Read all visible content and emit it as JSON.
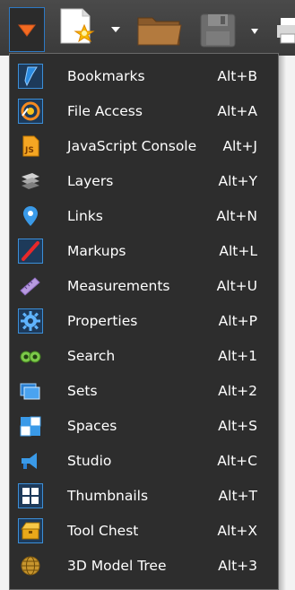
{
  "colors": {
    "toolbar_bg": "#3f3f3f",
    "menu_bg": "#2d2d2d",
    "menu_border": "#6b6b6b",
    "selected_frame": "#3c8fd8",
    "text": "#ffffff",
    "accent_orange": "#f36b21"
  },
  "toolbar": {
    "buttons": [
      {
        "id": "panels",
        "icon": "orange-down-triangle-icon"
      },
      {
        "id": "new",
        "icon": "new-document-icon",
        "has_dropdown": true
      },
      {
        "id": "open",
        "icon": "folder-icon"
      },
      {
        "id": "save",
        "icon": "floppy-disk-icon",
        "has_dropdown": true
      },
      {
        "id": "print",
        "icon": "printer-icon"
      }
    ]
  },
  "menu": {
    "items": [
      {
        "label": "Bookmarks",
        "shortcut": "Alt+B",
        "icon": "bookmark-icon",
        "selected": true
      },
      {
        "label": "File Access",
        "shortcut": "Alt+A",
        "icon": "file-access-icon",
        "selected": true
      },
      {
        "label": "JavaScript Console",
        "shortcut": "Alt+J",
        "icon": "javascript-icon",
        "selected": false
      },
      {
        "label": "Layers",
        "shortcut": "Alt+Y",
        "icon": "layers-icon",
        "selected": false
      },
      {
        "label": "Links",
        "shortcut": "Alt+N",
        "icon": "link-pin-icon",
        "selected": false
      },
      {
        "label": "Markups",
        "shortcut": "Alt+L",
        "icon": "markup-pen-icon",
        "selected": true
      },
      {
        "label": "Measurements",
        "shortcut": "Alt+U",
        "icon": "ruler-icon",
        "selected": false
      },
      {
        "label": "Properties",
        "shortcut": "Alt+P",
        "icon": "gear-icon",
        "selected": true
      },
      {
        "label": "Search",
        "shortcut": "Alt+1",
        "icon": "binoculars-icon",
        "selected": false
      },
      {
        "label": "Sets",
        "shortcut": "Alt+2",
        "icon": "sets-icon",
        "selected": false
      },
      {
        "label": "Spaces",
        "shortcut": "Alt+S",
        "icon": "spaces-icon",
        "selected": false
      },
      {
        "label": "Studio",
        "shortcut": "Alt+C",
        "icon": "studio-icon",
        "selected": false
      },
      {
        "label": "Thumbnails",
        "shortcut": "Alt+T",
        "icon": "thumbnails-icon",
        "selected": true
      },
      {
        "label": "Tool Chest",
        "shortcut": "Alt+X",
        "icon": "tool-chest-icon",
        "selected": true
      },
      {
        "label": "3D Model Tree",
        "shortcut": "Alt+3",
        "icon": "globe-model-icon",
        "selected": false
      }
    ]
  }
}
